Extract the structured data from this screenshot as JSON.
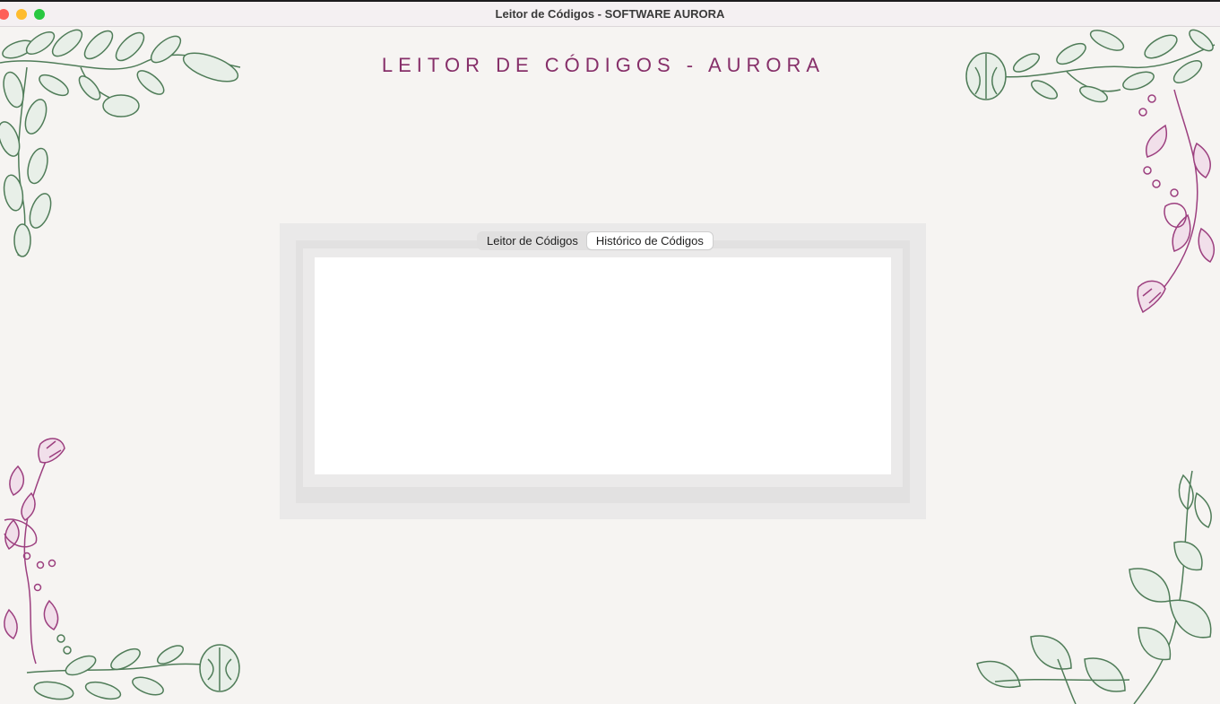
{
  "window": {
    "title": "Leitor de Códigos - SOFTWARE AURORA"
  },
  "app": {
    "heading": "LEITOR DE CÓDIGOS - AURORA"
  },
  "tabs": [
    {
      "label": "Leitor de Códigos",
      "active": false
    },
    {
      "label": "Histórico de Códigos",
      "active": true
    }
  ],
  "colors": {
    "heading": "#862f69",
    "background": "#f6f4f2",
    "foliage_green": "#4f7c58",
    "foliage_plum": "#9c3f7f"
  }
}
